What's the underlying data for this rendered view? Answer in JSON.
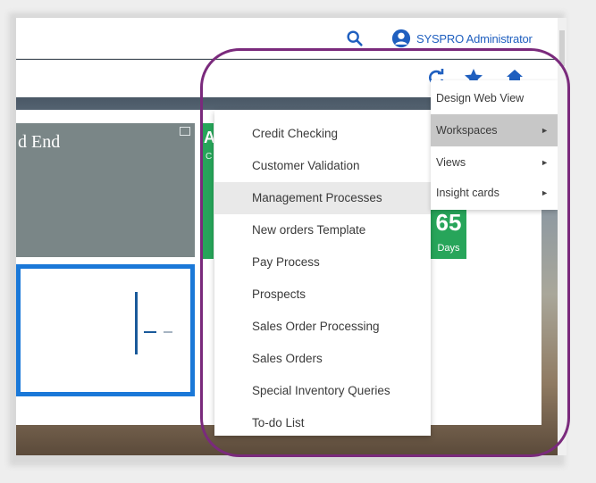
{
  "header": {
    "user_name": "SYSPRO Administrator"
  },
  "dashboard": {
    "card_title": "d End",
    "strip_text": "A",
    "strip_sub": "C",
    "metric_value": "65",
    "metric_unit": "Days"
  },
  "context_menu": {
    "items": [
      {
        "label": "Design Web View",
        "has_submenu": false,
        "active": false
      },
      {
        "label": "Workspaces",
        "has_submenu": true,
        "active": true
      },
      {
        "label": "Views",
        "has_submenu": true,
        "active": false
      },
      {
        "label": "Insight cards",
        "has_submenu": true,
        "active": false
      }
    ]
  },
  "workspaces_submenu": {
    "items": [
      {
        "label": "Credit Checking",
        "active": false
      },
      {
        "label": "Customer Validation",
        "active": false
      },
      {
        "label": "Management Processes",
        "active": true
      },
      {
        "label": "New orders Template",
        "active": false
      },
      {
        "label": "Pay Process",
        "active": false
      },
      {
        "label": "Prospects",
        "active": false
      },
      {
        "label": "Sales Order Processing",
        "active": false
      },
      {
        "label": "Sales Orders",
        "active": false
      },
      {
        "label": "Special Inventory Queries",
        "active": false
      },
      {
        "label": "To-do List",
        "active": false
      }
    ]
  },
  "colors": {
    "accent_blue": "#1a78d8",
    "metric_green": "#27a55a",
    "highlight_purple": "#7a2a7c",
    "user_link": "#1f5fbf"
  },
  "icons": {
    "search": "search-icon",
    "user": "user-circle-icon",
    "refresh": "refresh-icon",
    "favorite": "star-icon",
    "home": "home-icon"
  }
}
